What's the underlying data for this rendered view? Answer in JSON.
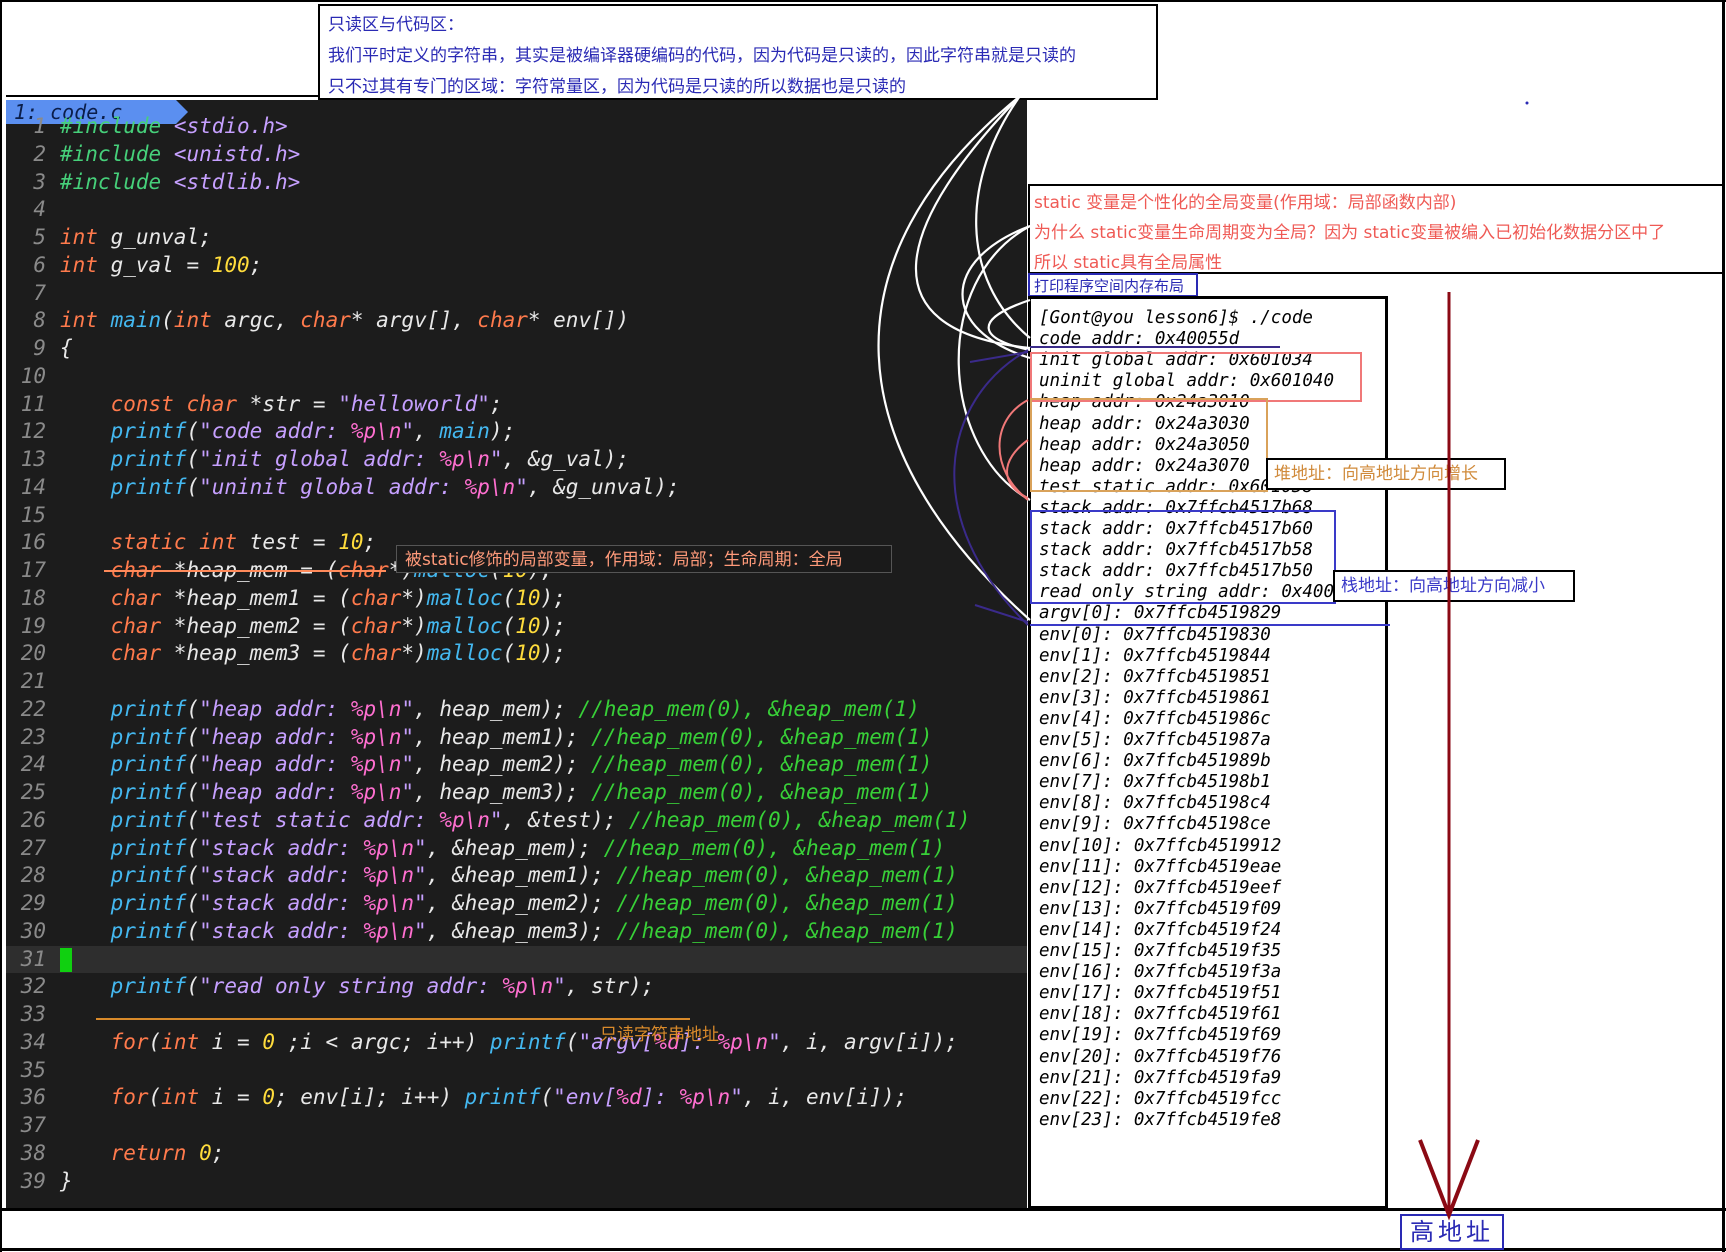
{
  "top_note": {
    "title": "只读区与代码区：",
    "line1": "我们平时定义的字符串，其实是被编译器硬编码的代码，因为代码是只读的，因此字符串就是只读的",
    "line2": "只不过其有专门的区域：字符常量区，因为代码是只读的所以数据也是只读的"
  },
  "editor": {
    "tab_label": "1: code.c",
    "cursor_line": 31,
    "lines": [
      {
        "n": "1"
      },
      {
        "n": "2"
      },
      {
        "n": "3"
      },
      {
        "n": "4"
      },
      {
        "n": "5"
      },
      {
        "n": "6"
      },
      {
        "n": "7"
      },
      {
        "n": "8"
      },
      {
        "n": "9"
      },
      {
        "n": "10"
      },
      {
        "n": "11"
      },
      {
        "n": "12"
      },
      {
        "n": "13"
      },
      {
        "n": "14"
      },
      {
        "n": "15"
      },
      {
        "n": "16"
      },
      {
        "n": "17"
      },
      {
        "n": "18"
      },
      {
        "n": "19"
      },
      {
        "n": "20"
      },
      {
        "n": "21"
      },
      {
        "n": "22"
      },
      {
        "n": "23"
      },
      {
        "n": "24"
      },
      {
        "n": "25"
      },
      {
        "n": "26"
      },
      {
        "n": "27"
      },
      {
        "n": "28"
      },
      {
        "n": "29"
      },
      {
        "n": "30"
      },
      {
        "n": "31"
      },
      {
        "n": "32"
      },
      {
        "n": "33"
      },
      {
        "n": "34"
      },
      {
        "n": "35"
      },
      {
        "n": "36"
      },
      {
        "n": "37"
      },
      {
        "n": "38"
      },
      {
        "n": "39"
      }
    ],
    "code": [
      [
        [
          "pp",
          "#include"
        ],
        [
          "c",
          " "
        ],
        [
          "inc",
          "<stdio.h>"
        ]
      ],
      [
        [
          "pp",
          "#include"
        ],
        [
          "c",
          " "
        ],
        [
          "inc",
          "<unistd.h>"
        ]
      ],
      [
        [
          "pp",
          "#include"
        ],
        [
          "c",
          " "
        ],
        [
          "inc",
          "<stdlib.h>"
        ]
      ],
      [],
      [
        [
          "type",
          "int"
        ],
        [
          "c",
          " g_unval;"
        ]
      ],
      [
        [
          "type",
          "int"
        ],
        [
          "c",
          " g_val = "
        ],
        [
          "num",
          "100"
        ],
        [
          "c",
          ";"
        ]
      ],
      [],
      [
        [
          "type",
          "int"
        ],
        [
          "c",
          " "
        ],
        [
          "fn",
          "main"
        ],
        [
          "c",
          "("
        ],
        [
          "type",
          "int"
        ],
        [
          "c",
          " argc, "
        ],
        [
          "type",
          "char"
        ],
        [
          "c",
          "* argv[], "
        ],
        [
          "type",
          "char"
        ],
        [
          "c",
          "* env[])"
        ]
      ],
      [
        [
          "c",
          "{"
        ]
      ],
      [],
      [
        [
          "c",
          "    "
        ],
        [
          "type",
          "const"
        ],
        [
          "c",
          " "
        ],
        [
          "type",
          "char"
        ],
        [
          "c",
          " *str = "
        ],
        [
          "str",
          "\"helloworld\""
        ],
        [
          "c",
          ";"
        ]
      ],
      [
        [
          "c",
          "    "
        ],
        [
          "fn",
          "printf"
        ],
        [
          "c",
          "("
        ],
        [
          "str",
          "\"code addr: "
        ],
        [
          "esc",
          "%p\\n"
        ],
        [
          "str",
          "\""
        ],
        [
          "c",
          ", "
        ],
        [
          "fn",
          "main"
        ],
        [
          "c",
          ");"
        ]
      ],
      [
        [
          "c",
          "    "
        ],
        [
          "fn",
          "printf"
        ],
        [
          "c",
          "("
        ],
        [
          "str",
          "\"init global addr: "
        ],
        [
          "esc",
          "%p\\n"
        ],
        [
          "str",
          "\""
        ],
        [
          "c",
          ", &g_val);"
        ]
      ],
      [
        [
          "c",
          "    "
        ],
        [
          "fn",
          "printf"
        ],
        [
          "c",
          "("
        ],
        [
          "str",
          "\"uninit global addr: "
        ],
        [
          "esc",
          "%p\\n"
        ],
        [
          "str",
          "\""
        ],
        [
          "c",
          ", &g_unval);"
        ]
      ],
      [],
      [
        [
          "c",
          "    "
        ],
        [
          "type",
          "static"
        ],
        [
          "c",
          " "
        ],
        [
          "type",
          "int"
        ],
        [
          "c",
          " test = "
        ],
        [
          "num",
          "10"
        ],
        [
          "c",
          ";"
        ]
      ],
      [
        [
          "c",
          "    "
        ],
        [
          "type",
          "char"
        ],
        [
          "c",
          " *heap_mem = ("
        ],
        [
          "type",
          "char"
        ],
        [
          "c",
          "*)"
        ],
        [
          "fn",
          "malloc"
        ],
        [
          "c",
          "("
        ],
        [
          "num",
          "10"
        ],
        [
          "c",
          ");"
        ]
      ],
      [
        [
          "c",
          "    "
        ],
        [
          "type",
          "char"
        ],
        [
          "c",
          " *heap_mem1 = ("
        ],
        [
          "type",
          "char"
        ],
        [
          "c",
          "*)"
        ],
        [
          "fn",
          "malloc"
        ],
        [
          "c",
          "("
        ],
        [
          "num",
          "10"
        ],
        [
          "c",
          ");"
        ]
      ],
      [
        [
          "c",
          "    "
        ],
        [
          "type",
          "char"
        ],
        [
          "c",
          " *heap_mem2 = ("
        ],
        [
          "type",
          "char"
        ],
        [
          "c",
          "*)"
        ],
        [
          "fn",
          "malloc"
        ],
        [
          "c",
          "("
        ],
        [
          "num",
          "10"
        ],
        [
          "c",
          ");"
        ]
      ],
      [
        [
          "c",
          "    "
        ],
        [
          "type",
          "char"
        ],
        [
          "c",
          " *heap_mem3 = ("
        ],
        [
          "type",
          "char"
        ],
        [
          "c",
          "*)"
        ],
        [
          "fn",
          "malloc"
        ],
        [
          "c",
          "("
        ],
        [
          "num",
          "10"
        ],
        [
          "c",
          ");"
        ]
      ],
      [],
      [
        [
          "c",
          "    "
        ],
        [
          "fn",
          "printf"
        ],
        [
          "c",
          "("
        ],
        [
          "str",
          "\"heap addr: "
        ],
        [
          "esc",
          "%p\\n"
        ],
        [
          "str",
          "\""
        ],
        [
          "c",
          ", heap_mem); "
        ],
        [
          "com",
          "//heap_mem(0), &heap_mem(1)"
        ]
      ],
      [
        [
          "c",
          "    "
        ],
        [
          "fn",
          "printf"
        ],
        [
          "c",
          "("
        ],
        [
          "str",
          "\"heap addr: "
        ],
        [
          "esc",
          "%p\\n"
        ],
        [
          "str",
          "\""
        ],
        [
          "c",
          ", heap_mem1); "
        ],
        [
          "com",
          "//heap_mem(0), &heap_mem(1)"
        ]
      ],
      [
        [
          "c",
          "    "
        ],
        [
          "fn",
          "printf"
        ],
        [
          "c",
          "("
        ],
        [
          "str",
          "\"heap addr: "
        ],
        [
          "esc",
          "%p\\n"
        ],
        [
          "str",
          "\""
        ],
        [
          "c",
          ", heap_mem2); "
        ],
        [
          "com",
          "//heap_mem(0), &heap_mem(1)"
        ]
      ],
      [
        [
          "c",
          "    "
        ],
        [
          "fn",
          "printf"
        ],
        [
          "c",
          "("
        ],
        [
          "str",
          "\"heap addr: "
        ],
        [
          "esc",
          "%p\\n"
        ],
        [
          "str",
          "\""
        ],
        [
          "c",
          ", heap_mem3); "
        ],
        [
          "com",
          "//heap_mem(0), &heap_mem(1)"
        ]
      ],
      [
        [
          "c",
          "    "
        ],
        [
          "fn",
          "printf"
        ],
        [
          "c",
          "("
        ],
        [
          "str",
          "\"test static addr: "
        ],
        [
          "esc",
          "%p\\n"
        ],
        [
          "str",
          "\""
        ],
        [
          "c",
          ", &test); "
        ],
        [
          "com",
          "//heap_mem(0), &heap_mem(1)"
        ]
      ],
      [
        [
          "c",
          "    "
        ],
        [
          "fn",
          "printf"
        ],
        [
          "c",
          "("
        ],
        [
          "str",
          "\"stack addr: "
        ],
        [
          "esc",
          "%p\\n"
        ],
        [
          "str",
          "\""
        ],
        [
          "c",
          ", &heap_mem); "
        ],
        [
          "com",
          "//heap_mem(0), &heap_mem(1)"
        ]
      ],
      [
        [
          "c",
          "    "
        ],
        [
          "fn",
          "printf"
        ],
        [
          "c",
          "("
        ],
        [
          "str",
          "\"stack addr: "
        ],
        [
          "esc",
          "%p\\n"
        ],
        [
          "str",
          "\""
        ],
        [
          "c",
          ", &heap_mem1); "
        ],
        [
          "com",
          "//heap_mem(0), &heap_mem(1)"
        ]
      ],
      [
        [
          "c",
          "    "
        ],
        [
          "fn",
          "printf"
        ],
        [
          "c",
          "("
        ],
        [
          "str",
          "\"stack addr: "
        ],
        [
          "esc",
          "%p\\n"
        ],
        [
          "str",
          "\""
        ],
        [
          "c",
          ", &heap_mem2); "
        ],
        [
          "com",
          "//heap_mem(0), &heap_mem(1)"
        ]
      ],
      [
        [
          "c",
          "    "
        ],
        [
          "fn",
          "printf"
        ],
        [
          "c",
          "("
        ],
        [
          "str",
          "\"stack addr: "
        ],
        [
          "esc",
          "%p\\n"
        ],
        [
          "str",
          "\""
        ],
        [
          "c",
          ", &heap_mem3); "
        ],
        [
          "com",
          "//heap_mem(0), &heap_mem(1)"
        ]
      ],
      [],
      [
        [
          "c",
          "    "
        ],
        [
          "fn",
          "printf"
        ],
        [
          "c",
          "("
        ],
        [
          "str",
          "\"read only string addr: "
        ],
        [
          "esc",
          "%p\\n"
        ],
        [
          "str",
          "\""
        ],
        [
          "c",
          ", str);"
        ]
      ],
      [],
      [
        [
          "c",
          "    "
        ],
        [
          "type",
          "for"
        ],
        [
          "c",
          "("
        ],
        [
          "type",
          "int"
        ],
        [
          "c",
          " i = "
        ],
        [
          "num",
          "0"
        ],
        [
          "c",
          " ;i < argc; i++) "
        ],
        [
          "fn",
          "printf"
        ],
        [
          "c",
          "("
        ],
        [
          "str",
          "\"argv["
        ],
        [
          "esc",
          "%d"
        ],
        [
          "str",
          "]: "
        ],
        [
          "esc",
          "%p\\n"
        ],
        [
          "str",
          "\""
        ],
        [
          "c",
          ", i, argv[i]);"
        ]
      ],
      [],
      [
        [
          "c",
          "    "
        ],
        [
          "type",
          "for"
        ],
        [
          "c",
          "("
        ],
        [
          "type",
          "int"
        ],
        [
          "c",
          " i = "
        ],
        [
          "num",
          "0"
        ],
        [
          "c",
          "; env[i]; i++) "
        ],
        [
          "fn",
          "printf"
        ],
        [
          "c",
          "("
        ],
        [
          "str",
          "\"env["
        ],
        [
          "esc",
          "%d"
        ],
        [
          "str",
          "]: "
        ],
        [
          "esc",
          "%p\\n"
        ],
        [
          "str",
          "\""
        ],
        [
          "c",
          ", i, env[i]);"
        ]
      ],
      [],
      [
        [
          "c",
          "    "
        ],
        [
          "type",
          "return"
        ],
        [
          "c",
          " "
        ],
        [
          "num",
          "0"
        ],
        [
          "c",
          ";"
        ]
      ],
      [
        [
          "c",
          "}"
        ]
      ]
    ]
  },
  "annotations": {
    "static_note": "被static修饰的局部变量，作用域：局部；生命周期：全局",
    "ro_note": "只读字符串地址",
    "static_box": {
      "line1": "static 变量是个性化的全局变量(作用域：局部函数内部)",
      "line2": "为什么 static变量生命周期变为全局？因为 static变量被编入已初始化数据分区中了",
      "line3": "所以 static具有全局属性"
    },
    "layout_label": "打印程序空间内存布局",
    "heap_note": "堆地址：向高地址方向增长",
    "stack_note": "栈地址：向高地址方向减小",
    "high_addr": "高地址"
  },
  "terminal": {
    "lines": [
      "[Gont@you lesson6]$ ./code",
      "code addr: 0x40055d",
      "init global addr: 0x601034",
      "uninit global addr: 0x601040",
      "heap addr: 0x24a3010",
      "heap addr: 0x24a3030",
      "heap addr: 0x24a3050",
      "heap addr: 0x24a3070",
      "test static addr: 0x601038",
      "stack addr: 0x7ffcb4517b68",
      "stack addr: 0x7ffcb4517b60",
      "stack addr: 0x7ffcb4517b58",
      "stack addr: 0x7ffcb4517b50",
      "read only string addr: 0x400800",
      "argv[0]: 0x7ffcb4519829",
      "env[0]: 0x7ffcb4519830",
      "env[1]: 0x7ffcb4519844",
      "env[2]: 0x7ffcb4519851",
      "env[3]: 0x7ffcb4519861",
      "env[4]: 0x7ffcb451986c",
      "env[5]: 0x7ffcb451987a",
      "env[6]: 0x7ffcb451989b",
      "env[7]: 0x7ffcb45198b1",
      "env[8]: 0x7ffcb45198c4",
      "env[9]: 0x7ffcb45198ce",
      "env[10]: 0x7ffcb4519912",
      "env[11]: 0x7ffcb4519eae",
      "env[12]: 0x7ffcb4519eef",
      "env[13]: 0x7ffcb4519f09",
      "env[14]: 0x7ffcb4519f24",
      "env[15]: 0x7ffcb4519f35",
      "env[16]: 0x7ffcb4519f3a",
      "env[17]: 0x7ffcb4519f51",
      "env[18]: 0x7ffcb4519f61",
      "env[19]: 0x7ffcb4519f69",
      "env[20]: 0x7ffcb4519f76",
      "env[21]: 0x7ffcb4519fa9",
      "env[22]: 0x7ffcb4519fcc",
      "env[23]: 0x7ffcb4519fe8"
    ]
  },
  "colors": {
    "editor_bg": "#1c1c1c",
    "tab_bg": "#5b8ff0",
    "keyword": "#ff7a4c",
    "function": "#44b8f0",
    "string": "#c6a0ff",
    "number": "#ffdc3c",
    "comment": "#38d038",
    "annotation_blue": "#2a2ab4",
    "annotation_red": "#ef5a55",
    "arrow_darkred": "#8b0a14"
  }
}
